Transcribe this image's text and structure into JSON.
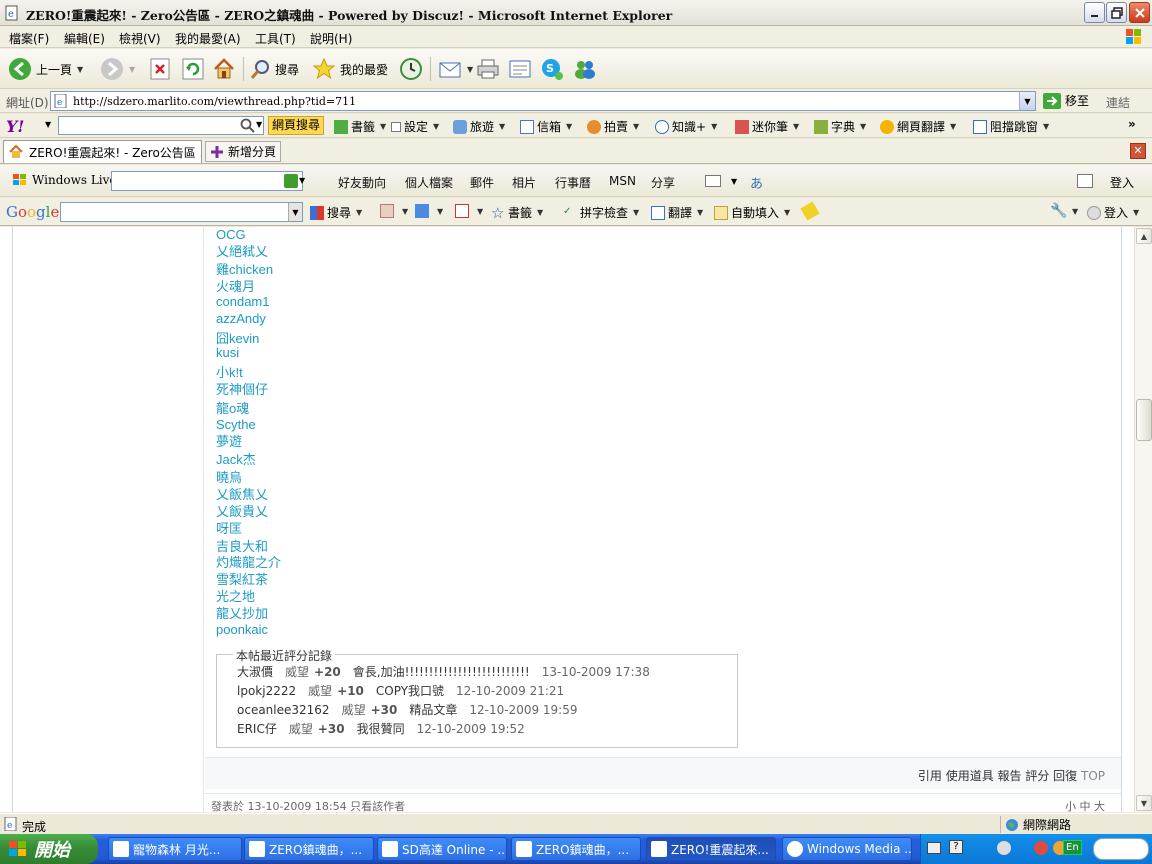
{
  "window": {
    "title": "ZERO!重震起來! - Zero公告區 - ZERO之鎮魂曲 - Powered by Discuz! - Microsoft Internet Explorer"
  },
  "menu": [
    "檔案(F)",
    "編輯(E)",
    "檢視(V)",
    "我的最愛(A)",
    "工具(T)",
    "說明(H)"
  ],
  "toolbar": {
    "back": "上一頁",
    "search": "搜尋",
    "favorites": "我的最愛"
  },
  "address": {
    "label": "網址(D)",
    "url": "http://sdzero.marlito.com/viewthread.php?tid=711",
    "go": "移至",
    "links": "連結"
  },
  "yahoo": {
    "logo": "Y!",
    "search_button": "網頁搜尋",
    "items": [
      "書籤",
      "設定",
      "旅遊",
      "信箱",
      "拍賣",
      "知識+",
      "迷你筆",
      "字典",
      "網頁翻譯",
      "阻擋跳窗"
    ]
  },
  "tabs": {
    "active": "ZERO!重震起來! - Zero公告區 ...",
    "new_tab": "新增分頁"
  },
  "live": {
    "logo": "Windows Live",
    "links": [
      "好友動向",
      "個人檔案",
      "郵件",
      "相片",
      "行事曆",
      "MSN",
      "分享"
    ],
    "login": "登入"
  },
  "google": {
    "logo": "Google",
    "search": "搜尋",
    "bookmarks": "書籤",
    "spellcheck": "拼字檢查",
    "translate": "翻譯",
    "autofill": "自動填入",
    "login": "登入"
  },
  "content": {
    "names": [
      "OCG",
      "乂絕弒乂",
      "雞chicken",
      "火魂月",
      "condam1",
      "azzAndy",
      "囧kevin",
      "kusi",
      "小k!t",
      "死神個仔",
      "龍o魂",
      "Scythe",
      "夢遊",
      "Jack杰",
      "曉烏",
      "乂飯焦乂",
      "乂飯貴乂",
      "呀匡",
      "吉良大和",
      "灼熾龍之介",
      "雪梨紅茶",
      "光之地",
      "龍乂抄加",
      "poonkaic"
    ],
    "rating": {
      "legend": "本帖最近評分記錄",
      "rows": [
        {
          "user": "大淑價",
          "kind": "威望",
          "points": "+20",
          "reason": "會長,加油!!!!!!!!!!!!!!!!!!!!!!!!!!",
          "time": "13-10-2009 17:38"
        },
        {
          "user": "lpokj2222",
          "kind": "威望",
          "points": "+10",
          "reason": "COPY我口號",
          "time": "12-10-2009 21:21"
        },
        {
          "user": "oceanlee32162",
          "kind": "威望",
          "points": "+30",
          "reason": "精品文章",
          "time": "12-10-2009 19:59"
        },
        {
          "user": "ERIC仔",
          "kind": "威望",
          "points": "+30",
          "reason": "我很贊同",
          "time": "12-10-2009 19:52"
        }
      ]
    },
    "actions": "引用 使用道具 報告 評分 回復",
    "top": "TOP",
    "next_post_meta": "發表於 13-10-2009 18:54  只看該作者",
    "font_size": "小 中 大"
  },
  "status": {
    "text": "完成",
    "zone": "網際網路"
  },
  "taskbar": {
    "start": "開始",
    "tasks": [
      "寵物森林 月光...",
      "ZERO鎮魂曲，...",
      "SD高達 Online - ...",
      "ZERO鎮魂曲，...",
      "ZERO!重震起來...",
      "Windows Media ..."
    ],
    "tray_lang": "En"
  },
  "colors": {
    "link": "#1C9BC4",
    "taskbar": "#245EDB",
    "start": "#388E38"
  }
}
